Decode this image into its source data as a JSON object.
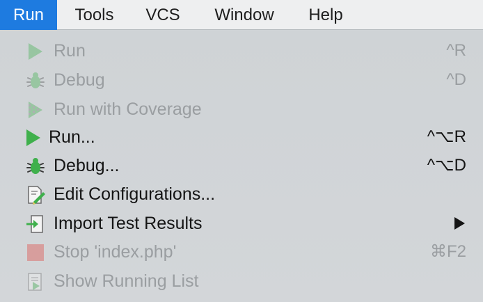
{
  "menubar": {
    "items": [
      {
        "label": "Run",
        "active": true
      },
      {
        "label": "Tools"
      },
      {
        "label": "VCS"
      },
      {
        "label": "Window"
      },
      {
        "label": "Help"
      }
    ]
  },
  "run_menu": {
    "items": [
      {
        "label": "Run",
        "shortcut": "^R",
        "enabled": false,
        "icon": "run-icon"
      },
      {
        "label": "Debug",
        "shortcut": "^D",
        "enabled": false,
        "icon": "debug-icon"
      },
      {
        "label": "Run with Coverage",
        "shortcut": "",
        "enabled": false,
        "icon": "coverage-icon"
      },
      {
        "label": "Run...",
        "shortcut": "^⌥R",
        "enabled": true,
        "icon": "run-icon"
      },
      {
        "label": "Debug...",
        "shortcut": "^⌥D",
        "enabled": true,
        "icon": "debug-icon"
      },
      {
        "label": "Edit Configurations...",
        "shortcut": "",
        "enabled": true,
        "icon": "edit-configurations-icon"
      },
      {
        "label": "Import Test Results",
        "shortcut": "",
        "enabled": true,
        "icon": "import-icon",
        "submenu": true
      },
      {
        "label": "Stop 'index.php'",
        "shortcut": "⌘F2",
        "enabled": false,
        "icon": "stop-icon"
      },
      {
        "label": "Show Running List",
        "shortcut": "",
        "enabled": false,
        "icon": "running-list-icon"
      }
    ]
  },
  "colors": {
    "active_menu": "#1e7be0",
    "run_green": "#3fb04c",
    "stop_red": "#e0443e"
  }
}
